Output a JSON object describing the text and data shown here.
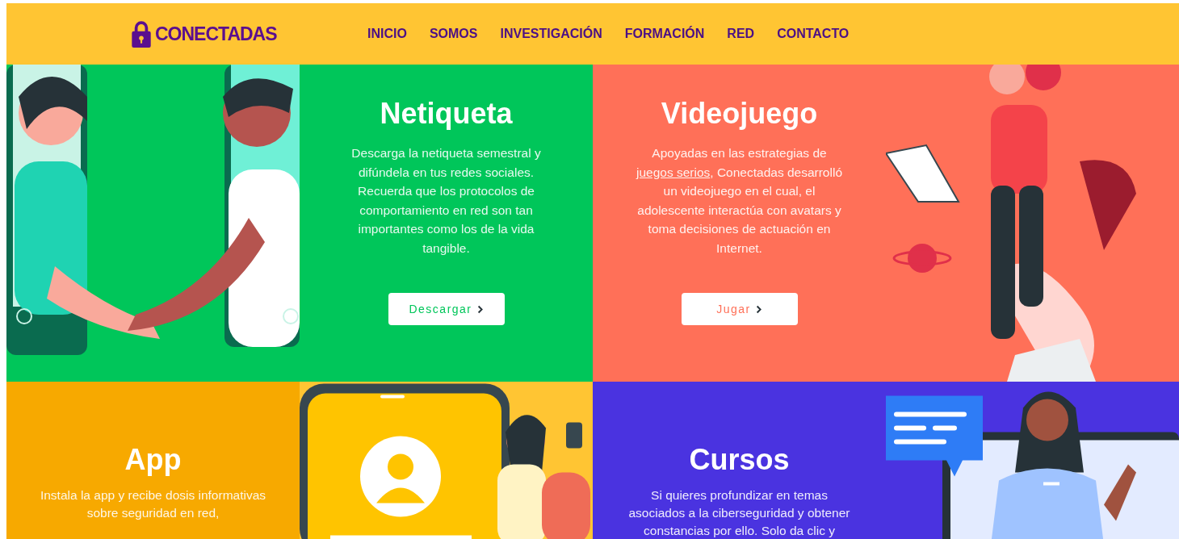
{
  "header": {
    "logo": "CONECTADAS",
    "nav": [
      "INICIO",
      "SOMOS",
      "INVESTIGACIÓN",
      "FORMACIÓN",
      "RED",
      "CONTACTO"
    ]
  },
  "tiles": [
    {
      "kind": "handshake",
      "color": "#00c65a"
    },
    {
      "kind": "text",
      "color": "#00c65a",
      "title": "Netiqueta",
      "text": "Descarga la netiqueta semestral y difúndela en tus redes sociales. Recuerda que los protocolos de comportamiento en red son tan importantes como los de la vida tangible.",
      "button": "Descargar"
    },
    {
      "kind": "text",
      "color": "#ff7058",
      "title": "Videojuego",
      "text_before": "Apoyadas en las estrategias de ",
      "link": "juegos serios",
      "text_after": ", Conectadas desarrolló un videojuego en el cual, el adolescente interactúa con avatars y toma decisiones de actuación en Internet.",
      "button": "Jugar"
    },
    {
      "kind": "jumper",
      "color": "#ff7058"
    },
    {
      "kind": "text",
      "color": "#f7a900",
      "title": "App",
      "text": "Instala la app y recibe dosis informativas sobre seguridad en red,"
    },
    {
      "kind": "phone",
      "color": "#ffc533"
    },
    {
      "kind": "text",
      "color": "#4a33e0",
      "title": "Cursos",
      "text": "Si quieres profundizar en temas asociados a la ciberseguridad y obtener constancias por ello. Solo da clic y"
    },
    {
      "kind": "teacher",
      "color": "#4a33e0"
    }
  ]
}
